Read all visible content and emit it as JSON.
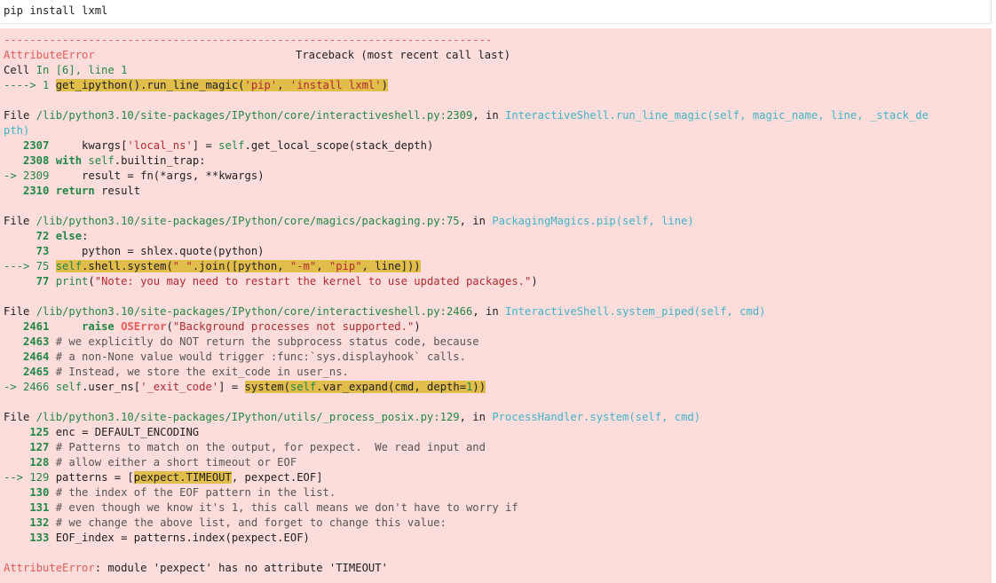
{
  "input_cell": {
    "code": "pip install lxml"
  },
  "colors": {
    "error_red": "#e75c58",
    "green": "#208844",
    "cyan": "#3fb5c4",
    "highlight": "#e1bd4b",
    "output_bg": "#fddcdc"
  },
  "header": {
    "dashes": "---------------------------------------------------------------------------",
    "error_name": "AttributeError",
    "traceback_label": "Traceback (most recent call last)",
    "cell_label": "Cell ",
    "cell_ref": "In [6], line 1",
    "arrow": "----> 1 ",
    "call": {
      "p1": "get_ipython().run_line_magic(",
      "s1": "'pip'",
      "p2": ", ",
      "s2": "'install lxml'",
      "p3": ")"
    }
  },
  "frame1": {
    "file_prefix": "File ",
    "path": "/lib/python3.10/site-packages/IPython/core/interactiveshell.py:2309",
    "in_text": ", in ",
    "func": "InteractiveShell.run_line_magic(self, magic_name, line, _stack_de",
    "func_wrap": "pth)",
    "lines": {
      "l2307": {
        "gutter": "   2307 ",
        "a": "    kwargs[",
        "s": "'local_ns'",
        "b": "] ",
        "eq": "=",
        "c": " ",
        "self": "self",
        "d": ".get_local_scope(stack_depth)"
      },
      "l2308": {
        "gutter": "   2308 ",
        "kw": "with",
        "c": " ",
        "self": "self",
        "d": ".builtin_trap:"
      },
      "l2309": {
        "arrow": "-> 2309 ",
        "a": "    result ",
        "eq": "=",
        "b": " fn(",
        "op1": "*",
        "c": "args, ",
        "op2": "**",
        "d": "kwargs)"
      },
      "l2310": {
        "gutter": "   2310 ",
        "kw": "return",
        "d": " result"
      }
    }
  },
  "frame2": {
    "file_prefix": "File ",
    "path": "/lib/python3.10/site-packages/IPython/core/magics/packaging.py:75",
    "in_text": ", in ",
    "func": "PackagingMagics.pip(self, line)",
    "lines": {
      "l72": {
        "gutter": "     72 ",
        "kw": "else",
        "d": ":"
      },
      "l73": {
        "gutter": "     73 ",
        "a": "    python ",
        "eq": "=",
        "d": " shlex.quote(python)"
      },
      "l75": {
        "arrow": "---> 75 ",
        "self": "self",
        "a": ".shell.system(",
        "s1": "\" \"",
        "b": ".join([python, ",
        "s2": "\"-m\"",
        "c": ", ",
        "s3": "\"pip\"",
        "d": ", line]))"
      },
      "l77": {
        "gutter": "     77 ",
        "bi": "print",
        "a": "(",
        "s": "\"Note: you may need to restart the kernel to use updated packages.\"",
        "d": ")"
      }
    }
  },
  "frame3": {
    "file_prefix": "File ",
    "path": "/lib/python3.10/site-packages/IPython/core/interactiveshell.py:2466",
    "in_text": ", in ",
    "func": "InteractiveShell.system_piped(self, cmd)",
    "lines": {
      "l2461": {
        "gutter": "   2461 ",
        "indent": "    ",
        "kw": "raise",
        "sp": " ",
        "exc": "OSError",
        "a": "(",
        "s": "\"Background processes not supported.\"",
        "d": ")"
      },
      "l2463": {
        "gutter": "   2463 ",
        "cm": "# we explicitly do NOT return the subprocess status code, because"
      },
      "l2464": {
        "gutter": "   2464 ",
        "cm": "# a non-None value would trigger :func:`sys.displayhook` calls."
      },
      "l2465": {
        "gutter": "   2465 ",
        "cm": "# Instead, we store the exit_code in user_ns."
      },
      "l2466": {
        "arrow": "-> 2466 ",
        "self": "self",
        "a": ".user_ns[",
        "s": "'_exit_code'",
        "b": "] ",
        "eq": "=",
        "c": " ",
        "h1": "system(",
        "hself": "self",
        "h2": ".var_expand(cmd, depth",
        "heq": "=",
        "hnum": "1",
        "h3": "))"
      }
    }
  },
  "frame4": {
    "file_prefix": "File ",
    "path": "/lib/python3.10/site-packages/IPython/utils/_process_posix.py:129",
    "in_text": ", in ",
    "func": "ProcessHandler.system(self, cmd)",
    "lines": {
      "l125": {
        "gutter": "    125 ",
        "a": "enc ",
        "eq": "=",
        "d": " DEFAULT_ENCODING"
      },
      "l127": {
        "gutter": "    127 ",
        "cm": "# Patterns to match on the output, for pexpect.  We read input and"
      },
      "l128": {
        "gutter": "    128 ",
        "cm": "# allow either a short timeout or EOF"
      },
      "l129": {
        "arrow": "--> 129 ",
        "a": "patterns ",
        "eq": "=",
        "b": " [",
        "h": "pexpect.TIMEOUT",
        "d": ", pexpect.EOF]"
      },
      "l130": {
        "gutter": "    130 ",
        "cm": "# the index of the EOF pattern in the list."
      },
      "l131": {
        "gutter": "    131 ",
        "cm": "# even though we know it's 1, this call means we don't have to worry if"
      },
      "l132": {
        "gutter": "    132 ",
        "cm": "# we change the above list, and forget to change this value:"
      },
      "l133": {
        "gutter": "    133 ",
        "a": "EOF_index ",
        "eq": "=",
        "d": " patterns.index(pexpect.EOF)"
      }
    }
  },
  "final_error": {
    "name": "AttributeError",
    "message": ": module 'pexpect' has no attribute 'TIMEOUT'"
  }
}
